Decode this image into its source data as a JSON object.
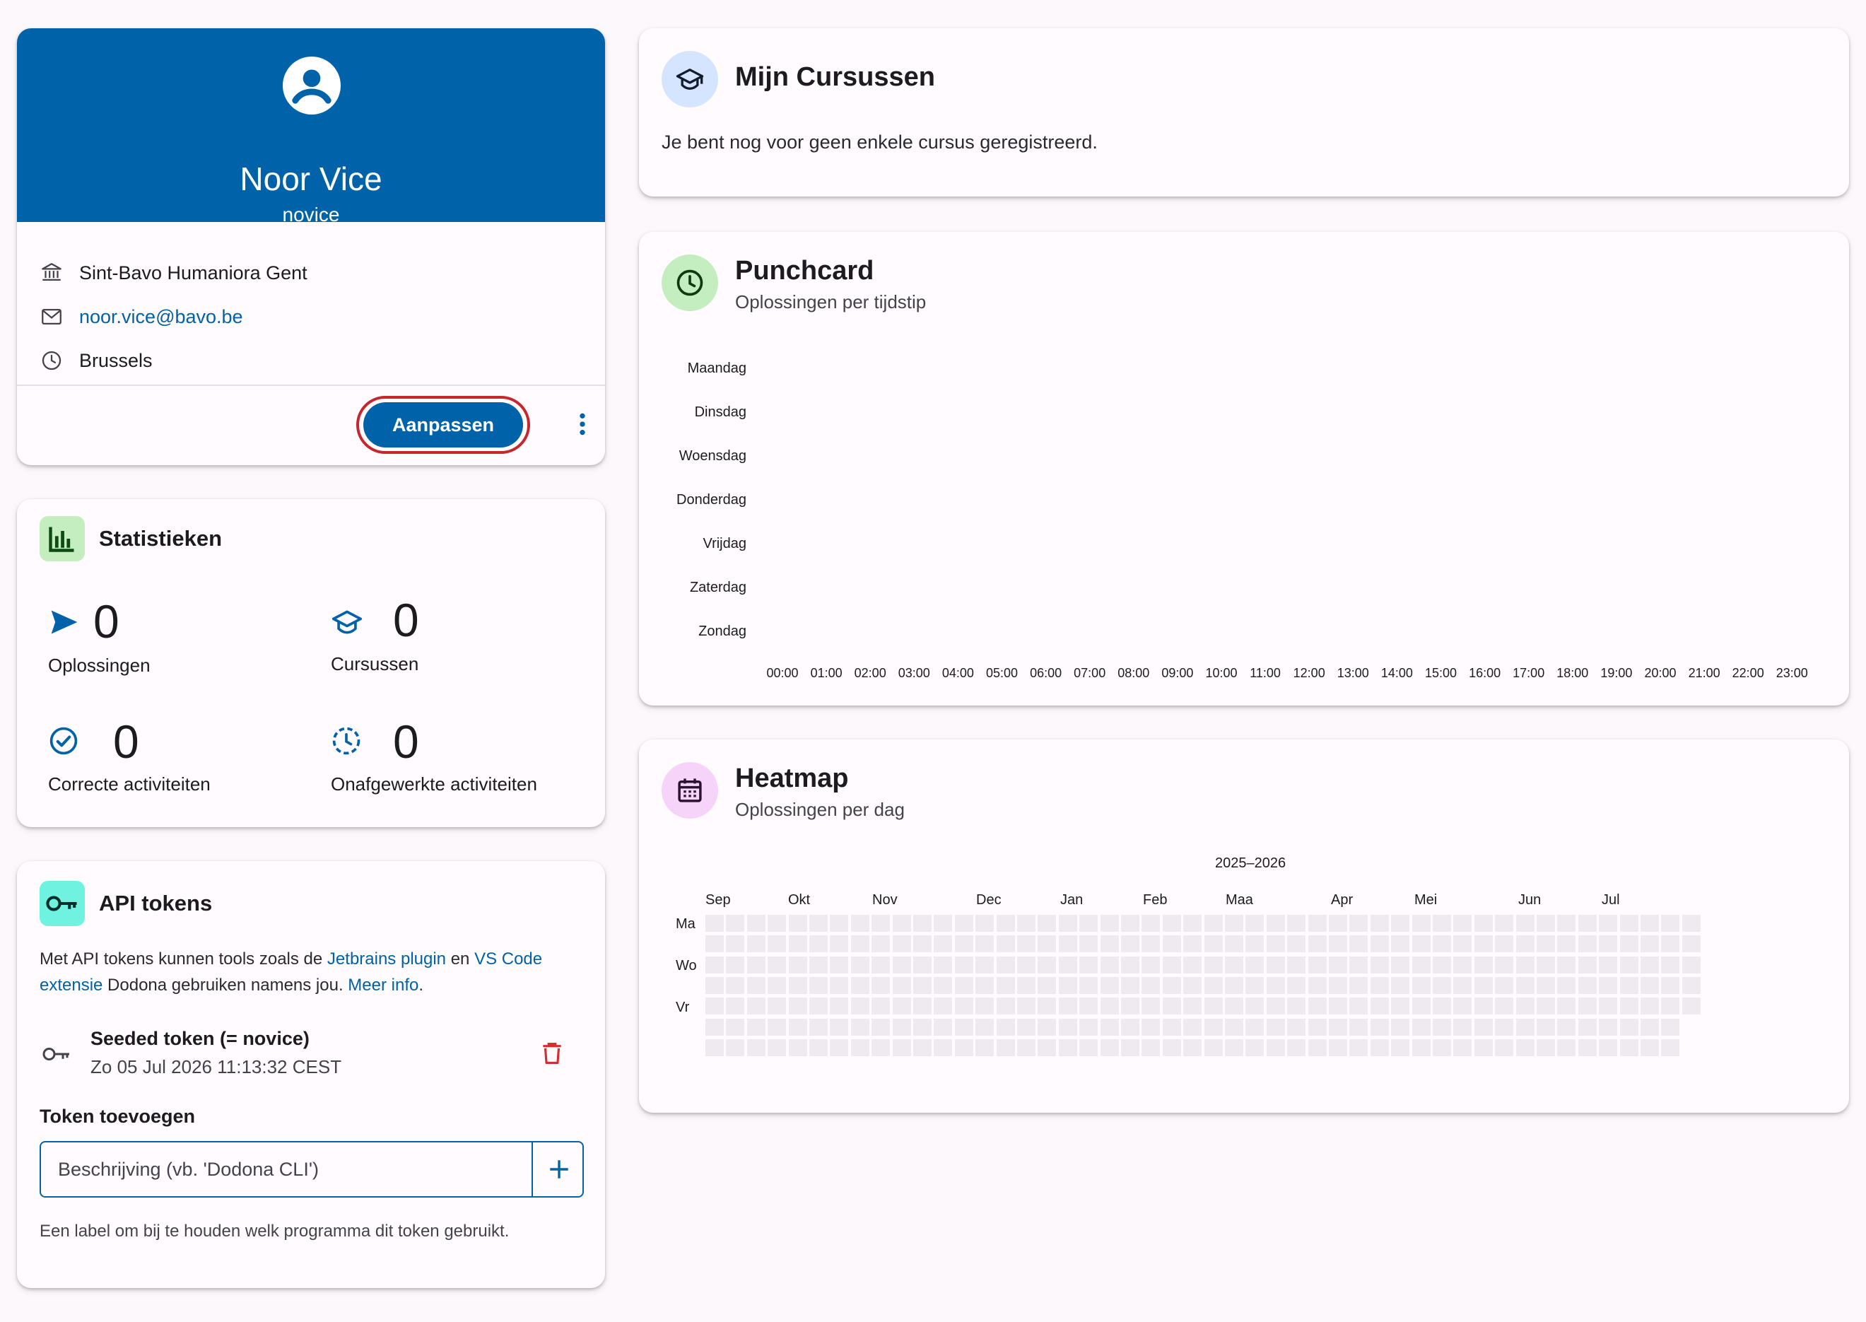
{
  "profile": {
    "name": "Noor Vice",
    "username": "novice",
    "institution": "Sint-Bavo Humaniora Gent",
    "email": "noor.vice@bavo.be",
    "timezone": "Brussels",
    "edit_label": "Aanpassen"
  },
  "stats": {
    "title": "Statistieken",
    "items": [
      {
        "value": "0",
        "label": "Oplossingen"
      },
      {
        "value": "0",
        "label": "Cursussen"
      },
      {
        "value": "0",
        "label": "Correcte activiteiten"
      },
      {
        "value": "0",
        "label": "Onafgewerkte activiteiten"
      }
    ]
  },
  "api": {
    "title": "API tokens",
    "desc_1": "Met API tokens kunnen tools zoals de ",
    "link_jetbrains": "Jetbrains plugin",
    "desc_2": " en ",
    "link_vscode": "VS Code extensie",
    "desc_3": " Dodona gebruiken namens jou. ",
    "link_more": "Meer info",
    "desc_4": ".",
    "token_name": "Seeded token (= novice)",
    "token_date": "Zo 05 Jul 2026 11:13:32 CEST",
    "add_label": "Token toevoegen",
    "input_placeholder": "Beschrijving (vb. 'Dodona CLI')",
    "input_help": "Een label om bij te houden welk programma dit token gebruikt."
  },
  "courses": {
    "title": "Mijn Cursussen",
    "empty": "Je bent nog voor geen enkele cursus geregistreerd."
  },
  "punchcard": {
    "title": "Punchcard",
    "subtitle": "Oplossingen per tijdstip",
    "days": [
      "Maandag",
      "Dinsdag",
      "Woensdag",
      "Donderdag",
      "Vrijdag",
      "Zaterdag",
      "Zondag"
    ],
    "hours": [
      "00:00",
      "01:00",
      "02:00",
      "03:00",
      "04:00",
      "05:00",
      "06:00",
      "07:00",
      "08:00",
      "09:00",
      "10:00",
      "11:00",
      "12:00",
      "13:00",
      "14:00",
      "15:00",
      "16:00",
      "17:00",
      "18:00",
      "19:00",
      "20:00",
      "21:00",
      "22:00",
      "23:00"
    ]
  },
  "heatmap": {
    "title": "Heatmap",
    "subtitle": "Oplossingen per dag",
    "year_label": "2025–2026",
    "months": [
      "Sep",
      "Okt",
      "Nov",
      "Dec",
      "Jan",
      "Feb",
      "Maa",
      "Apr",
      "Mei",
      "Jun",
      "Jul"
    ],
    "weekday_labels": [
      "Ma",
      "Wo",
      "Vr"
    ]
  },
  "colors": {
    "primary": "#0062a8",
    "danger": "#d32f2f",
    "stats_icon_bg": "#c4eec0",
    "api_icon_bg": "#6ff2e0",
    "courses_icon_bg": "#d5e5ff",
    "punch_icon_bg": "#c4eec0",
    "heat_icon_bg": "#f6d4fa"
  }
}
